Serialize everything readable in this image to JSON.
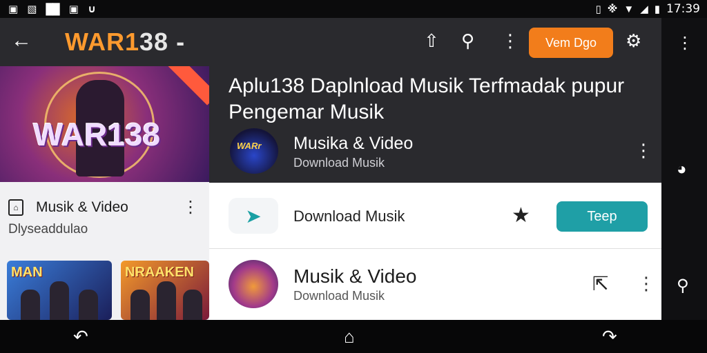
{
  "status_bar": {
    "time": "17:39",
    "left_icons": [
      "image-icon",
      "no-sim-icon",
      "notification-icon",
      "image-icon",
      "headset-icon"
    ],
    "right_icons": [
      "vibrate-icon",
      "bluetooth-icon",
      "wifi-icon",
      "signal-icon",
      "battery-icon"
    ]
  },
  "app_bar": {
    "back_icon": "arrow-left-icon",
    "brand_prefix": "WAR1",
    "brand_number": "38",
    "brand_suffix": " -",
    "cta_label": "Vem Dgo",
    "icons": [
      "share-icon",
      "search-icon",
      "more-vert-icon",
      "settings-icon"
    ]
  },
  "banner": {
    "title": "WAR138"
  },
  "left_list": {
    "item_title": "Musik & Video",
    "item_subtitle": "Dlyseaddulao",
    "thumbnails": [
      {
        "label": "MAN",
        "colors": [
          "#3a7dd9",
          "#1b1f5a"
        ]
      },
      {
        "label": "NRAAKEN",
        "colors": [
          "#f39a2a",
          "#7a1a3a"
        ]
      }
    ]
  },
  "main": {
    "headline": "Aplu138 Daplnload Musik Terfmadak pupur Pengemar Musik",
    "featured": {
      "avatar_label": "WARr",
      "title": "Musika & Video",
      "subtitle": "Download Musik"
    },
    "row1": {
      "icon": "send-icon",
      "label": "Download Musik",
      "star_icon": "star-icon",
      "button": "Teep"
    },
    "row2": {
      "title": "Musik & Video",
      "subtitle": "Download Musik",
      "arrow_icon": "arrow-up-left-icon"
    }
  },
  "rail": {
    "icons": [
      "more-vert-icon",
      "clock-icon",
      "key-icon"
    ]
  },
  "nav_bar": {
    "icons": [
      "back-nav-icon",
      "home-icon",
      "recents-icon"
    ]
  },
  "colors": {
    "accent_orange": "#f27d1b",
    "teal": "#1f9fa6",
    "dark_panel": "#2a2a2e"
  }
}
